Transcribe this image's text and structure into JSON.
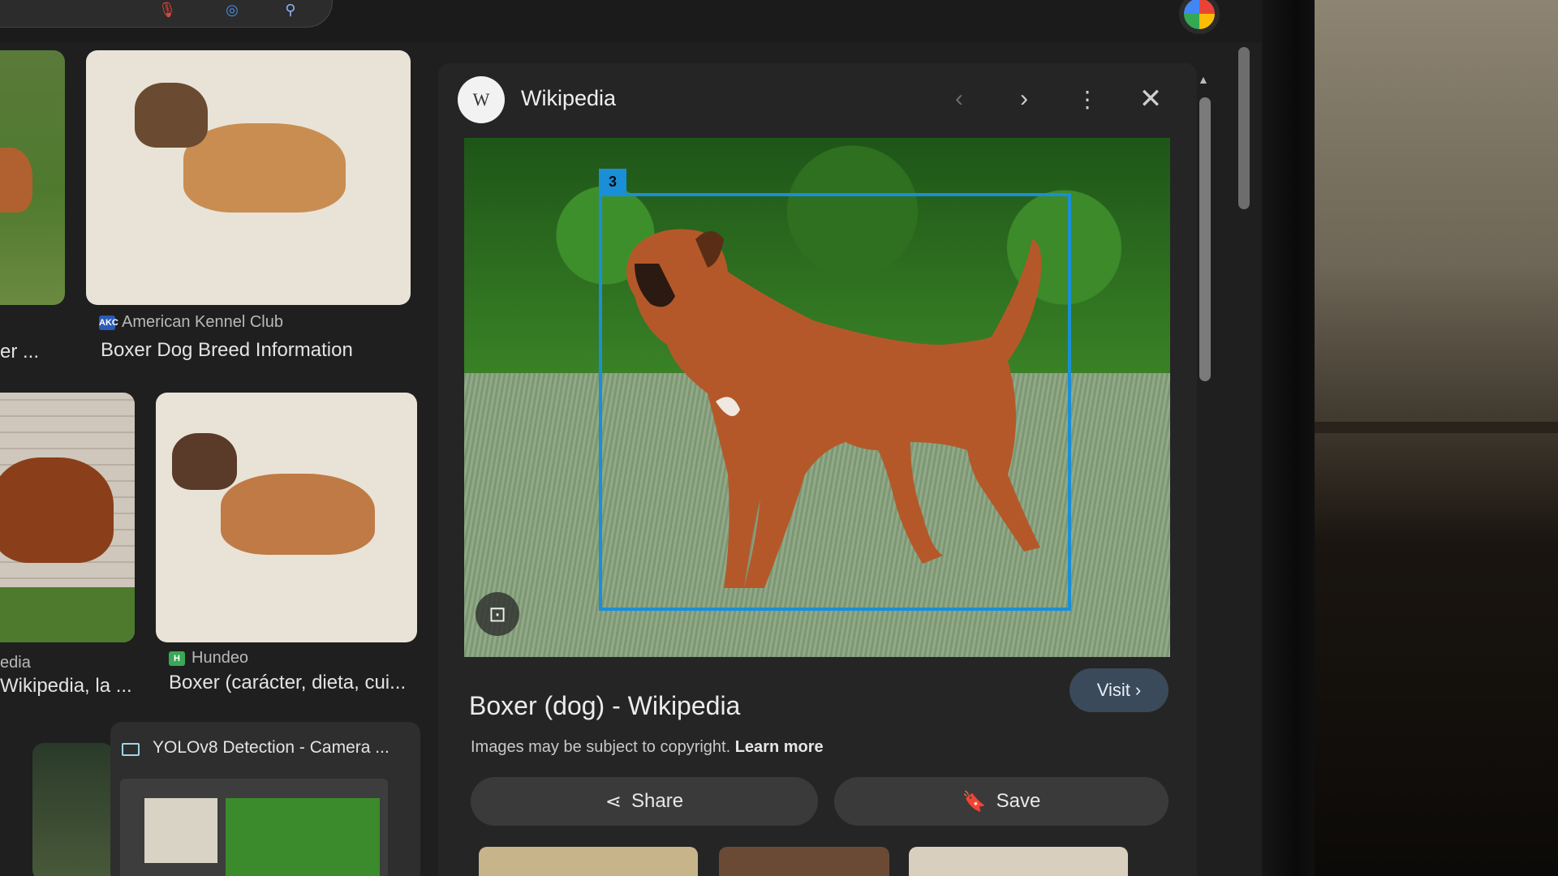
{
  "grid": {
    "row1": {
      "left_title": "er ...",
      "card2_source": "American Kennel Club",
      "card2_source_badge": "AKC",
      "card2_title": "Boxer Dog Breed Information"
    },
    "row2": {
      "left_source": "edia",
      "left_title": "Wikipedia, la ...",
      "card2_source": "Hundeo",
      "card2_source_badge": "H",
      "card2_title": "Boxer (carácter, dieta, cui..."
    },
    "row3": {
      "card_title": "YOLOv8 Detection - Camera ..."
    }
  },
  "panel": {
    "source_name": "Wikipedia",
    "logo_letter": "W",
    "detection_label": "3",
    "title": "Boxer (dog) - Wikipedia",
    "visit_label": "Visit",
    "copyright_text": "Images may be subject to copyright.",
    "learn_more": "Learn more",
    "share_label": "Share",
    "save_label": "Save"
  },
  "icons": {
    "mic": "microphone-icon",
    "lens": "google-lens-icon",
    "search": "search-icon",
    "apps": "apps-grid-icon",
    "prev": "chevron-left-icon",
    "next": "chevron-right-icon",
    "more": "more-vert-icon",
    "close": "close-icon"
  },
  "colors": {
    "detection_box": "#1a8fd8",
    "visit_button": "#3b4a5a",
    "panel_bg": "#252525"
  }
}
